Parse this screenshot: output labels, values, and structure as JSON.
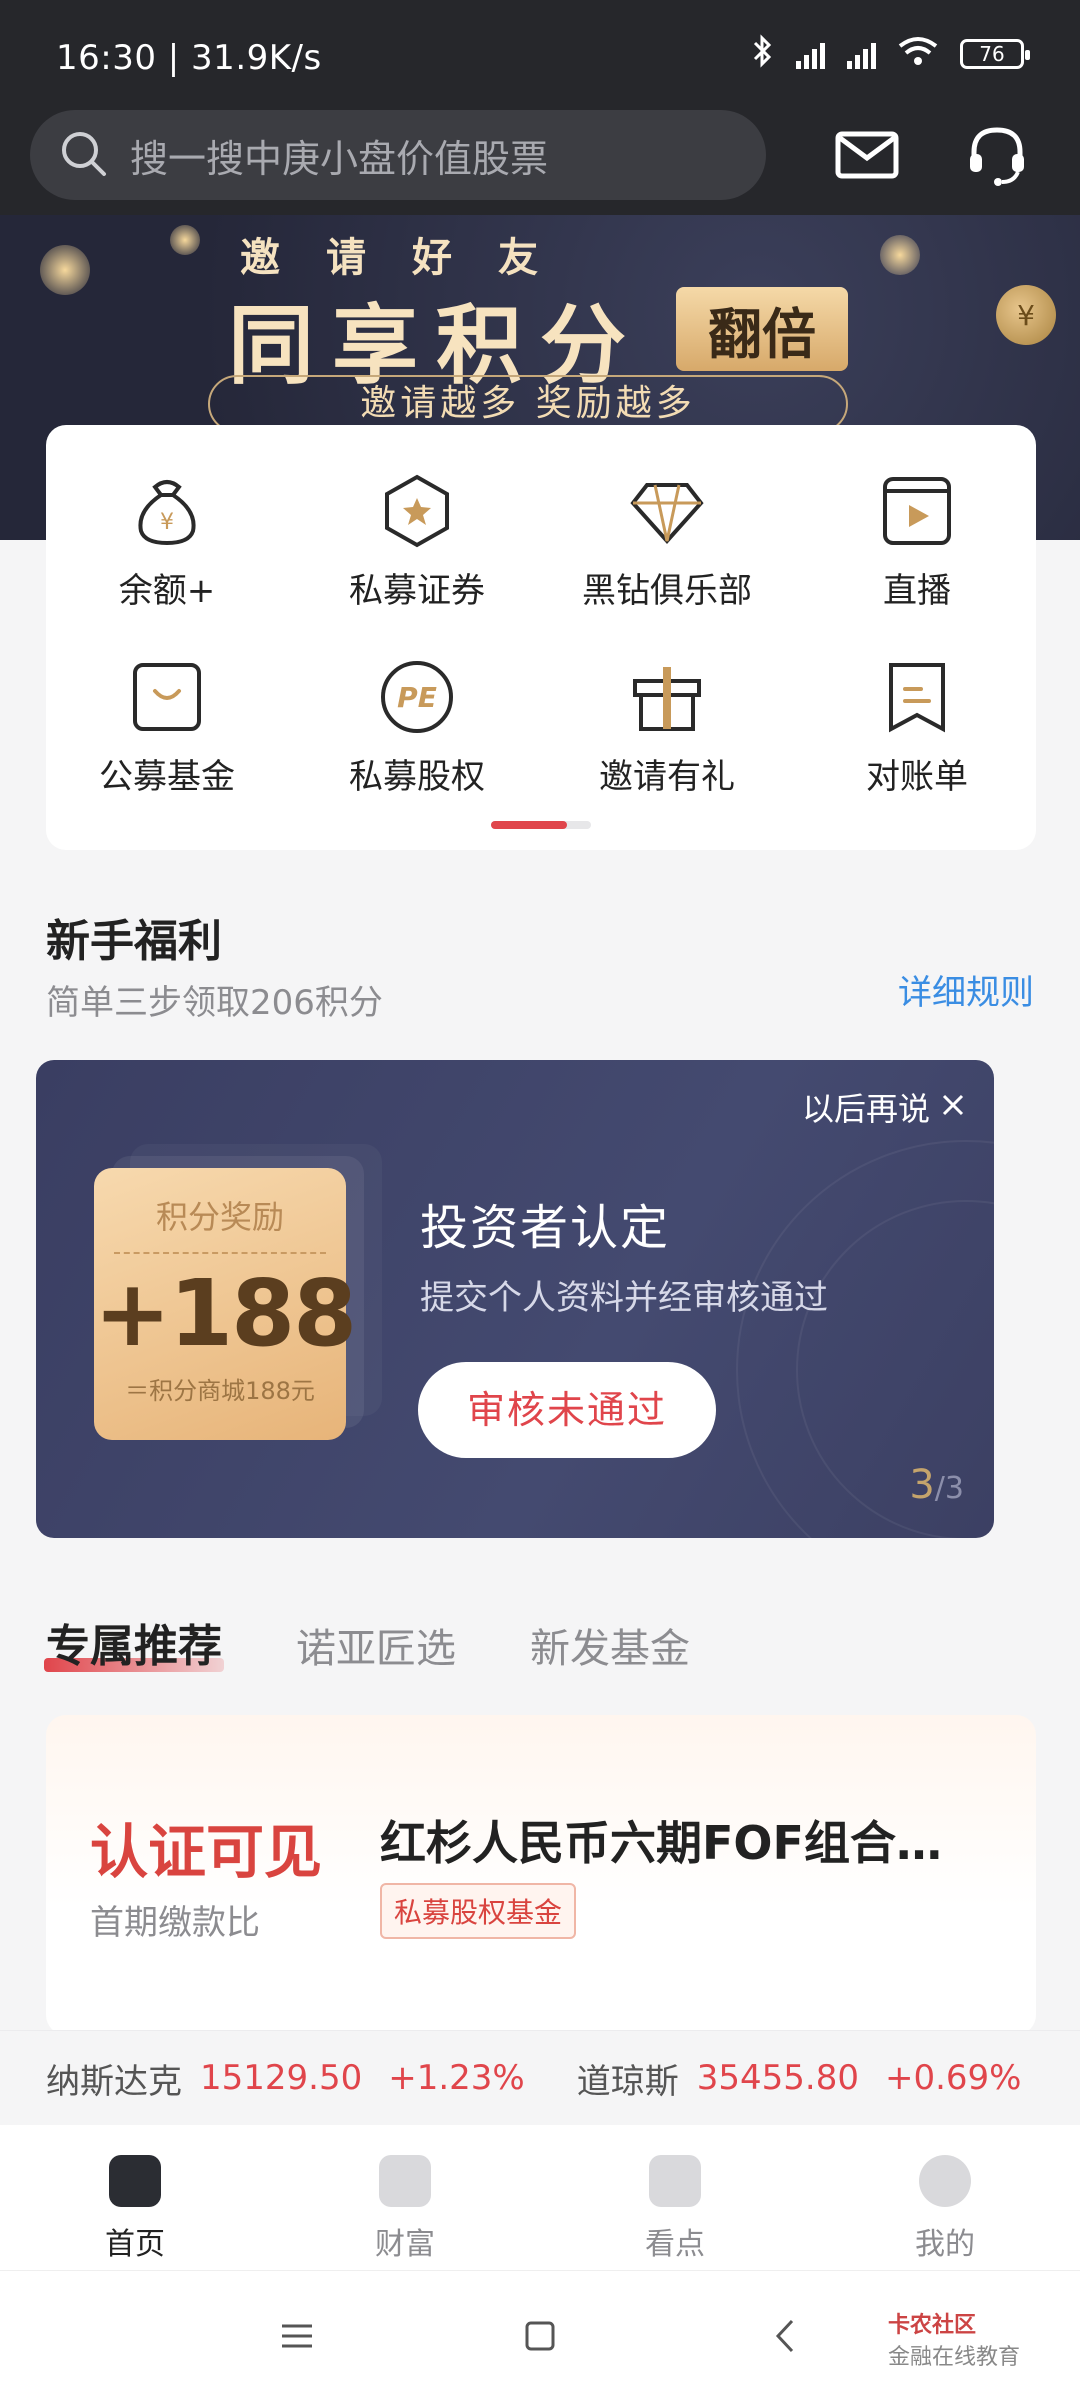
{
  "status_bar": {
    "time_speed": "16:30 | 31.9K/s",
    "battery": "76"
  },
  "header": {
    "search_placeholder": "搜一搜中庚小盘价值股票"
  },
  "banner": {
    "small_text": "邀请好友",
    "big_text": "同享积分",
    "badge": "翻倍",
    "pill_text": "邀请越多  奖励越多",
    "coin_symbol": "¥"
  },
  "grid": [
    {
      "label": "余额+",
      "icon": "money-bag-icon"
    },
    {
      "label": "私募证券",
      "icon": "star-hexagon-icon"
    },
    {
      "label": "黑钻俱乐部",
      "icon": "diamond-icon"
    },
    {
      "label": "直播",
      "icon": "play-screen-icon"
    },
    {
      "label": "公募基金",
      "icon": "smile-bag-icon"
    },
    {
      "label": "私募股权",
      "icon": "pe-circle-icon"
    },
    {
      "label": "邀请有礼",
      "icon": "gift-icon"
    },
    {
      "label": "对账单",
      "icon": "bookmark-icon"
    }
  ],
  "newbie": {
    "title": "新手福利",
    "subtitle": "简单三步领取206积分",
    "link": "详细规则"
  },
  "promo": {
    "later": "以后再说",
    "ticket_title": "积分奖励",
    "ticket_value": "+188",
    "ticket_note": "＝积分商城188元",
    "title": "投资者认定",
    "desc": "提交个人资料并经审核通过",
    "button": "审核未通过",
    "page_current": "3",
    "page_total": "/3"
  },
  "tabs": [
    {
      "label": "专属推荐"
    },
    {
      "label": "诺亚匠选"
    },
    {
      "label": "新发基金"
    }
  ],
  "fund": {
    "value": "认证可见",
    "value_label": "首期缴款比",
    "name": "红杉人民币六期FOF组合…",
    "tag": "私募股权基金"
  },
  "ticker": [
    {
      "name": "纳斯达克",
      "price": "15129.50",
      "change": "+1.23%"
    },
    {
      "name": "道琼斯",
      "price": "35455.80",
      "change": "+0.69%"
    }
  ],
  "bottom_nav": [
    {
      "label": "首页"
    },
    {
      "label": "财富"
    },
    {
      "label": "看点"
    },
    {
      "label": "我的"
    }
  ],
  "watermark": {
    "brand": "卡农社区",
    "sub": "金融在线教育"
  }
}
